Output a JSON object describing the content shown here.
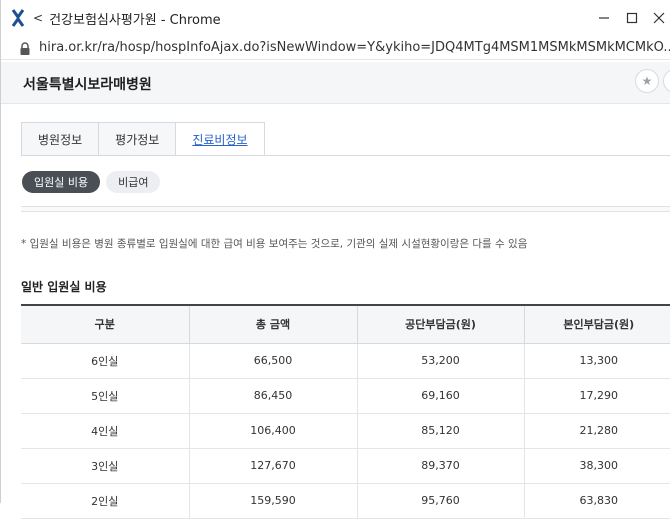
{
  "window": {
    "title": "건강보험심사평가원 - Chrome",
    "url": "hira.or.kr/ra/hosp/hospInfoAjax.do?isNewWindow=Y&ykiho=JDQ4MTg4MSM1MSMkMSMkMCMkO..."
  },
  "page": {
    "hospital_name": "서울특별시보라매병원"
  },
  "tabs": [
    {
      "label": "병원정보",
      "active": false
    },
    {
      "label": "평가정보",
      "active": false
    },
    {
      "label": "진료비정보",
      "active": true
    }
  ],
  "pills": [
    {
      "label": "입원실 비용",
      "active": true
    },
    {
      "label": "비급여",
      "active": false
    }
  ],
  "note": "* 입원실 비용은 병원 종류별로 입원실에 대한 급여 비용 보여주는 것으로, 기관의 실제 시설현황이랑은 다를 수 있음",
  "section_title": "일반 입원실 비용",
  "table": {
    "headers": [
      "구분",
      "총 금액",
      "공단부담금(원)",
      "본인부담금(원)"
    ],
    "rows": [
      [
        "6인실",
        "66,500",
        "53,200",
        "13,300"
      ],
      [
        "5인실",
        "86,450",
        "69,160",
        "17,290"
      ],
      [
        "4인실",
        "106,400",
        "85,120",
        "21,280"
      ],
      [
        "3인실",
        "127,670",
        "89,370",
        "38,300"
      ],
      [
        "2인실",
        "159,590",
        "95,760",
        "63,830"
      ]
    ]
  },
  "icons": {
    "app": "hira-logo-icon",
    "back": "chevron-left-icon",
    "lock": "lock-icon",
    "favorite": "star-icon"
  }
}
